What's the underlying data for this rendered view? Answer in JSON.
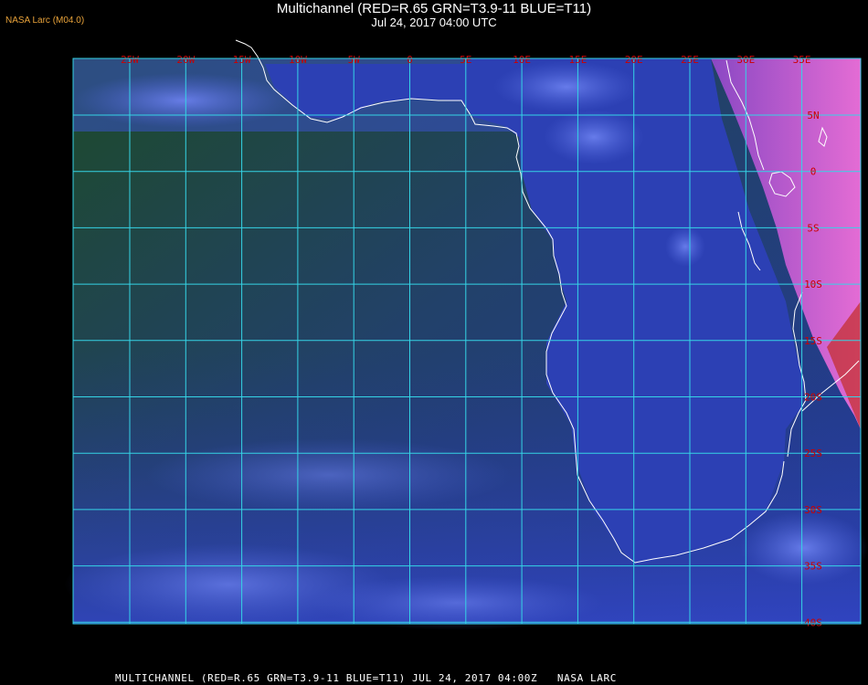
{
  "badge": "NASA Larc (M04.0)",
  "title": "Multichannel (RED=R.65 GRN=T3.9-11 BLUE=T11)",
  "subtitle": "Jul 24, 2017 04:00 UTC",
  "footer": "MULTICHANNEL (RED=R.65 GRN=T3.9-11 BLUE=T11) JUL 24, 2017 04:00Z   NASA LARC",
  "colors": {
    "ocean_green": "#1f4a2c",
    "ocean_blue": "#22338a",
    "land": "#2c3fae",
    "cloud": "#5a6ee0",
    "grid": "#35d4e6",
    "coast": "#ffffff",
    "label": "#cc0000",
    "east_land": "#c458c8"
  },
  "map": {
    "lon_labels": [
      "25W",
      "20W",
      "15W",
      "10W",
      "5W",
      "0",
      "5E",
      "10E",
      "15E",
      "20E",
      "25E",
      "30E",
      "35E"
    ],
    "lat_labels": [
      "5N",
      "0",
      "5S",
      "10S",
      "15S",
      "20S",
      "25S",
      "30S",
      "35S",
      "40S"
    ],
    "lon_values": [
      -25,
      -20,
      -15,
      -10,
      -5,
      0,
      5,
      10,
      15,
      20,
      25,
      30,
      35
    ],
    "lat_values": [
      5,
      0,
      -5,
      -10,
      -15,
      -20,
      -25,
      -30,
      -35,
      -40
    ]
  }
}
